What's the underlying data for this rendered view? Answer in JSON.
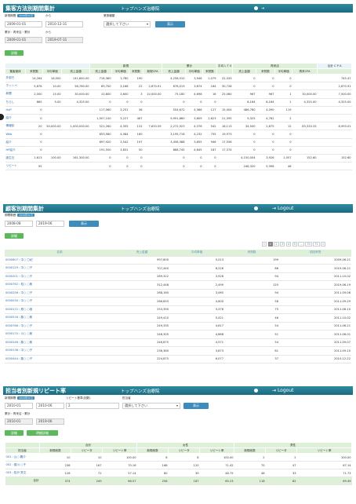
{
  "clinic": "トップハンズ治療院",
  "logout": "Logout",
  "s1": {
    "title": "集客方法別期間集計",
    "period_label": "新規期間",
    "period_badge": "2009年01月",
    "from_label": "から",
    "date_from": "2009-01-01",
    "date_to": "2010-12-31",
    "category_label": "業態種類",
    "category_value": "選択して下さい",
    "show": "表示",
    "cumul_label": "累計・再来店・累計",
    "cumul_from_label": "から",
    "cumul_from": "2009-01-01",
    "cumul_to": "2019-07-31",
    "detail": "詳細",
    "groups": [
      "新規",
      "累計",
      "平均 L T V",
      "再来店",
      "合計 C P A"
    ],
    "cols": [
      "集客媒体",
      "来院数",
      "平均単価",
      "売上金額",
      "売上金額",
      "平均単価",
      "来院数",
      "新規CPA",
      "売上金額",
      "平均単価",
      "来院数",
      "",
      "売上金額",
      "来院数",
      "平均単価",
      "再来CPA",
      ""
    ],
    "rows": [
      [
        "外部方",
        "14,264",
        "16,000",
        "141,840.00",
        "718,360",
        "3,780",
        "190",
        "",
        "4,258,510",
        "3,946",
        "1,079",
        "22,433",
        "0",
        "0",
        "0",
        "",
        "745.47"
      ],
      [
        "ホットペ",
        "5,876",
        "10.00",
        "58,760.00",
        "69,700",
        "3,168",
        "22",
        "2,670.91",
        "676,019",
        "3,674",
        "184",
        "30,728",
        "0",
        "0",
        "0",
        "",
        "2,670.91"
      ],
      [
        "新聞",
        "2,000",
        "15.00",
        "30,000.00",
        "10,800",
        "3,600",
        "3",
        "10,000.00",
        "75,180",
        "4,698",
        "16",
        "25,060",
        "967",
        "967",
        "1",
        "30,000.00",
        "7,500.00"
      ],
      [
        "ちらし",
        "865",
        "5.00",
        "4,325.00",
        "0",
        "0",
        "0",
        "",
        "0",
        "0",
        "0",
        "",
        "8,164",
        "8,164",
        "1",
        "4,325.00",
        "4,325.00"
      ],
      [
        "HoP",
        "0",
        "",
        "",
        "117,060",
        "3,251",
        "36",
        "",
        "554,672",
        "4,366",
        "127",
        "15,404",
        "486,780",
        "4,090",
        "119",
        "",
        ""
      ],
      [
        "紹介",
        "0",
        "",
        "",
        "1,507,100",
        "3,227",
        "467",
        "",
        "9,991,860",
        "3,609",
        "2,623",
        "21,395",
        "9,325",
        "4,762",
        "2",
        "",
        ""
      ],
      [
        "情報誌",
        "20",
        "50,000.00",
        "1,000,000.00",
        "521,260",
        "4,355",
        "131",
        "7,633.59",
        "2,272,923",
        "4,376",
        "542",
        "18,113",
        "34,500",
        "2,875",
        "12",
        "83,333.33",
        "6,993.01"
      ],
      [
        "Web",
        "0",
        "",
        "",
        "653,560",
        "4,084",
        "160",
        "",
        "3,195,716",
        "4,232",
        "755",
        "19,973",
        "0",
        "0",
        "0",
        "",
        ""
      ],
      [
        "紹介",
        "0",
        "",
        "",
        "697,920",
        "3,542",
        "197",
        "",
        "3,458,388",
        "3,655",
        "946",
        "17,556",
        "0",
        "0",
        "0",
        "",
        ""
      ],
      [
        "HP紹介",
        "0",
        "",
        "",
        "191,550",
        "3,831",
        "50",
        "",
        "868,745",
        "4,645",
        "187",
        "17,374",
        "0",
        "0",
        "0",
        "",
        ""
      ],
      [
        "誕生日",
        "1,613",
        "100.00",
        "161,300.00",
        "0",
        "0",
        "0",
        "",
        "0",
        "0",
        "0",
        "",
        "4,150,004",
        "3,926",
        "1,057",
        "152.60",
        "152.60"
      ],
      [
        "リピート",
        "95",
        "",
        "",
        "0",
        "0",
        "0",
        "",
        "0",
        "0",
        "0",
        "",
        "248,320",
        "5,398",
        "46",
        "",
        ""
      ]
    ]
  },
  "s2": {
    "title": "顧客別期間集計",
    "period_label": "期間範囲",
    "period_badge": "2009年01月",
    "date_from": "2008-08",
    "date_to": "2019-06",
    "show": "表示",
    "detail": "詳細",
    "cols": [
      "名前",
      "売上金額",
      "平均単価",
      "来院数",
      "初回来院"
    ],
    "rows": [
      [
        "0000607 : 中○ 〇紀",
        "997,600",
        "5,013",
        "199",
        "2009-06-21"
      ],
      [
        "0000129 : 中○ ○子",
        "707,440",
        "8,226",
        "86",
        "2019-06-21"
      ],
      [
        "0000201 : 中○ ○子",
        "269,322",
        "3,928",
        "94",
        "2011-10-02"
      ],
      [
        "0000762 : 松○ ○美",
        "312,448",
        "2,499",
        "125",
        "2019-06-19"
      ],
      [
        "0000256 : 中○ ○子",
        "288,165",
        "3,065",
        "94",
        "2011-09-06"
      ],
      [
        "0000030 : 中○ ○子",
        "266,855",
        "4,600",
        "58",
        "2011-09-29"
      ],
      [
        "0000172 : 原○ ○雄",
        "253,390",
        "3,378",
        "75",
        "2011-06-10"
      ],
      [
        "0000516 : 藤○ ○美",
        "249,410",
        "5,421",
        "46",
        "2011-10-02"
      ],
      [
        "0000766 : 中○ ○子",
        "249,335",
        "4,617",
        "54",
        "2011-06-21"
      ],
      [
        "0000170 : 川○ ○美",
        "248,305",
        "4,868",
        "51",
        "2011-06-01"
      ],
      [
        "0000246 : 藤○ ○美",
        "246,875",
        "4,571",
        "54",
        "2011-09-07"
      ],
      [
        "0000136 : 中○ ○子",
        "236,360",
        "3,873",
        "61",
        "2011-09-10"
      ],
      [
        "0000444 : 藤○ ○子",
        "224,875",
        "6,077",
        "37",
        "2010-12-22"
      ]
    ],
    "pages": [
      "«",
      "1",
      "2",
      "3",
      "4",
      "5",
      "…",
      "70",
      "71",
      "»"
    ]
  },
  "s3": {
    "title": "担当者別新規リピート率",
    "period_label": "新規期間",
    "period_badge": "2009年01月",
    "date_from": "2010-01",
    "date_to": "2010-06",
    "repeat_label": "リピート基準(回数)",
    "repeat_value": "2",
    "staff_label": "担当者",
    "staff_value": "選択して下さい",
    "show": "表示",
    "cumul_label": "累計・再来店・累計",
    "cumul_from": "2010-01",
    "cumul_to": "2019-06",
    "detail": "詳細",
    "detail2": "明細詳細",
    "groups": [
      "合計",
      "女性",
      "男性"
    ],
    "cols": [
      "担当者",
      "新規総数",
      "リピータ",
      "リピート率",
      "新規総数",
      "リピータ",
      "リピート率",
      "新規総数",
      "リピータ",
      "リピート率"
    ],
    "rows": [
      [
        "001 : 山○ 義介",
        "10",
        "10",
        "100.00",
        "8",
        "8",
        "100.00",
        "2",
        "2",
        "100.00"
      ],
      [
        "002 : 藤川 ○子",
        "238",
        "167",
        "70.16",
        "168",
        "120",
        "71.42",
        "70",
        "47",
        "67.14"
      ],
      [
        "003 : 松戸 秀文",
        "126",
        "72",
        "57.14",
        "80",
        "39",
        "48.75",
        "46",
        "33",
        "71.73"
      ]
    ],
    "total": [
      "合計",
      "374",
      "249",
      "66.57",
      "256",
      "167",
      "65.23",
      "118",
      "82",
      "69.49"
    ]
  }
}
